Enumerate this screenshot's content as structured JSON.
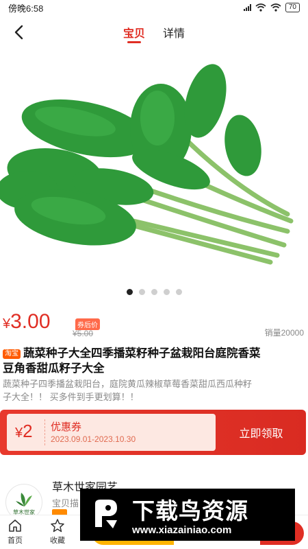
{
  "status_bar": {
    "time": "傍晚6:58",
    "battery": "70"
  },
  "nav": {
    "tabs": [
      {
        "label": "宝贝"
      },
      {
        "label": "详情"
      }
    ]
  },
  "carousel": {
    "dots": 5,
    "active_index": 0
  },
  "product": {
    "price_symbol": "¥",
    "price": "3.00",
    "coupon_price_tag": "券后价",
    "original_price": "¥5.00",
    "sales": "销量20000",
    "platform_badge": "淘宝",
    "title_line1": "蔬菜种子大全四季播菜籽种子盆栽阳台庭院香菜",
    "title_line2": "豆角香甜瓜籽子大全",
    "desc_line1": "蔬菜种子四季播盆栽阳台，庭院黄瓜辣椒草莓香菜甜瓜西瓜种籽",
    "desc_line2": "子大全！！ 买多件到手更划算！！"
  },
  "coupon": {
    "symbol": "¥",
    "amount": "2",
    "label": "优惠券",
    "date_range": "2023.09.01-2023.10.30",
    "button": "立即领取"
  },
  "store": {
    "name": "草木世家园艺",
    "subtitle": "宝贝描",
    "logo_text": "草木世家"
  },
  "bottom_bar": {
    "home": "首页",
    "favorite": "收藏"
  },
  "watermark": {
    "title": "下载鸟资源",
    "url": "www.xiazainiao.com"
  },
  "colors": {
    "accent": "#e02e24",
    "cart": "#ffb400"
  }
}
